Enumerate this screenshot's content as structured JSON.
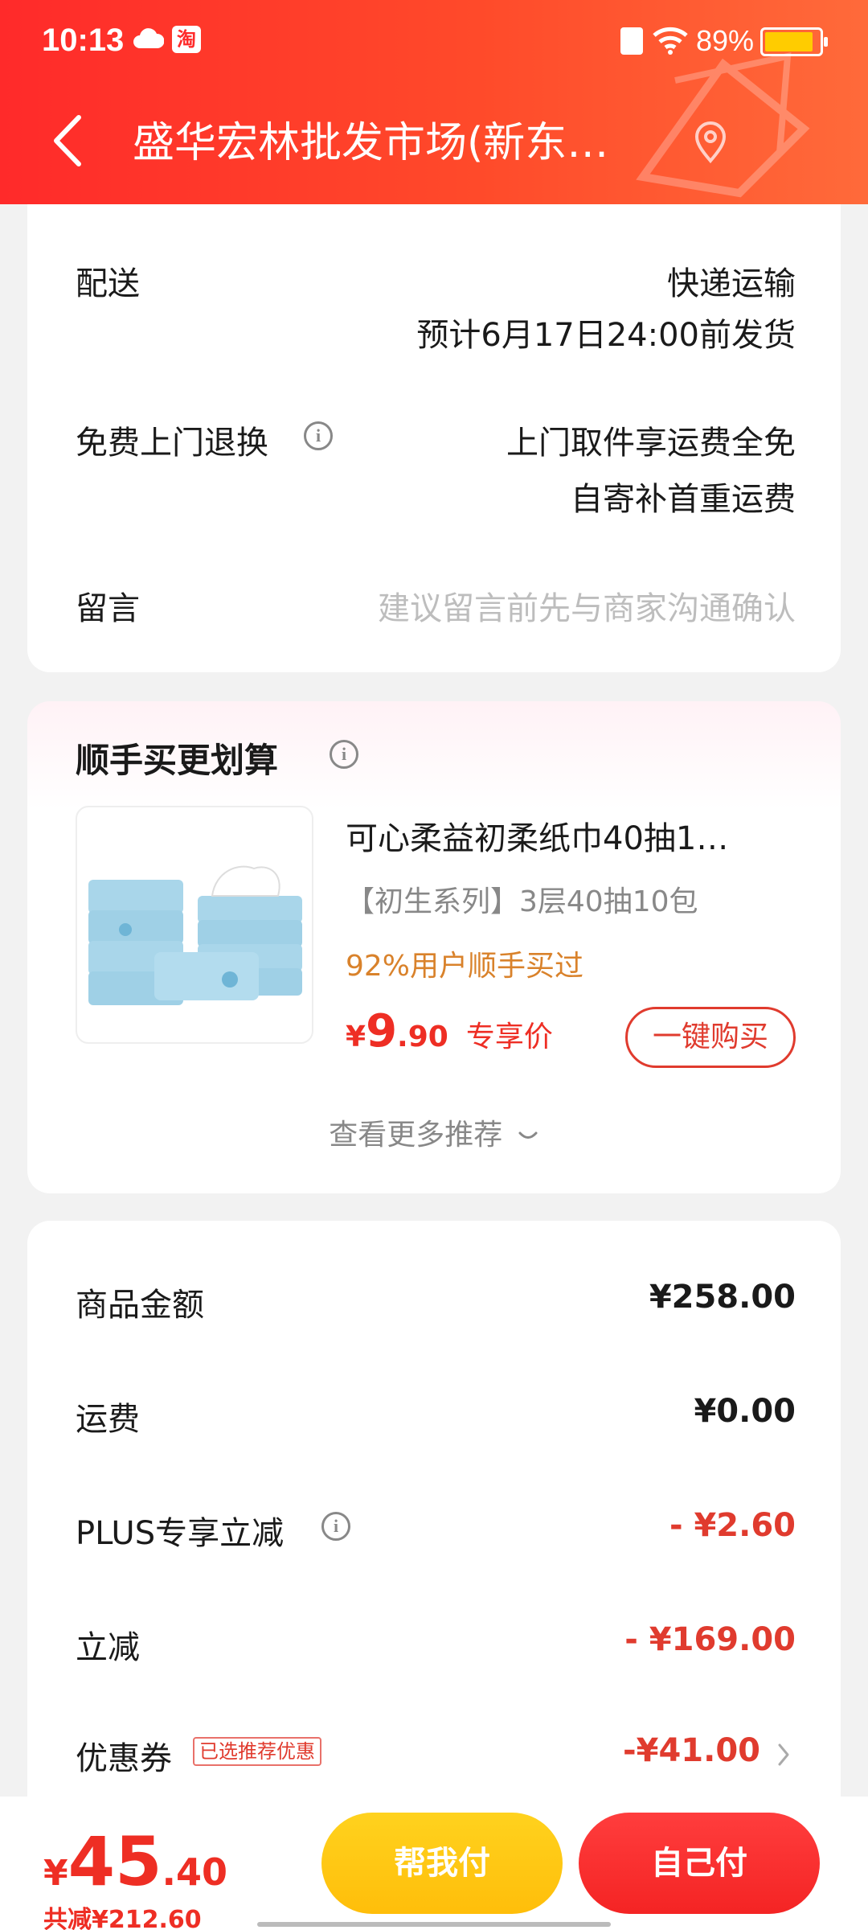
{
  "status_bar": {
    "time": "10:13",
    "app_badge": "淘",
    "battery_text": "89%",
    "battery_level": 0.89
  },
  "nav": {
    "title": "盛华宏林批发市场(新东…"
  },
  "delivery": {
    "shipping_label": "配送",
    "shipping_method": "快递运输",
    "shipping_eta": "预计6月17日24:00前发货",
    "return_label": "免费上门退换",
    "return_value_1": "上门取件享运费全免",
    "return_value_2": "自寄补首重运费",
    "message_label": "留言",
    "message_placeholder": "建议留言前先与商家沟通确认"
  },
  "addon": {
    "title": "顺手买更划算",
    "product_name": "可心柔益初柔纸巾40抽1…",
    "product_spec": "【初生系列】3层40抽10包",
    "buy_rate": "92%用户顺手买过",
    "price_symbol": "¥",
    "price_int": "9",
    "price_dec": ".90",
    "price_tag": "专享价",
    "buy_button": "一键购买",
    "more_label": "查看更多推荐"
  },
  "summary": {
    "goods_label": "商品金额",
    "goods_value": "¥258.00",
    "freight_label": "运费",
    "freight_value": "¥0.00",
    "plus_label": "PLUS专享立减",
    "plus_value": "- ¥2.60",
    "discount_label": "立减",
    "discount_value": "- ¥169.00",
    "coupon_label": "优惠券",
    "coupon_tag": "已选推荐优惠",
    "coupon_value": "-¥41.00"
  },
  "bottom": {
    "total_symbol": "¥",
    "total_int": "45",
    "total_dec": ".40",
    "saved": "共减¥212.60",
    "help_pay": "帮我付",
    "self_pay": "自己付"
  },
  "colors": {
    "brand_red": "#ff2a2a",
    "price_red": "#ee2e24",
    "accent_orange": "#d9822b",
    "help_yellow": "#ffc514"
  }
}
